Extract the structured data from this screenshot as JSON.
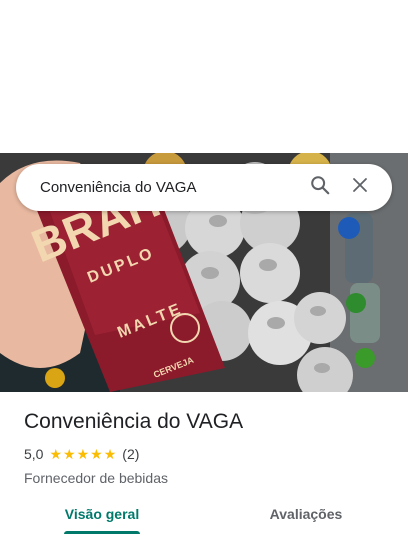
{
  "search": {
    "query": "Conveniência do VAGA",
    "icons": [
      "search-icon",
      "close-icon"
    ]
  },
  "place": {
    "name": "Conveniência do VAGA",
    "rating": "5,0",
    "stars": 5,
    "review_count": "(2)",
    "category": "Fornecedor de bebidas"
  },
  "tabs": [
    {
      "label": "Visão geral",
      "active": true
    },
    {
      "label": "Avaliações",
      "active": false
    }
  ],
  "photo": {
    "can_label_top": "BRAH",
    "can_label_mid": "DUPLO",
    "can_label_bottom": "MALTE",
    "can_label_small": "CERVEJA"
  },
  "colors": {
    "accent": "#00796b",
    "star": "#fbbc04",
    "can_red": "#8b1a2b"
  }
}
